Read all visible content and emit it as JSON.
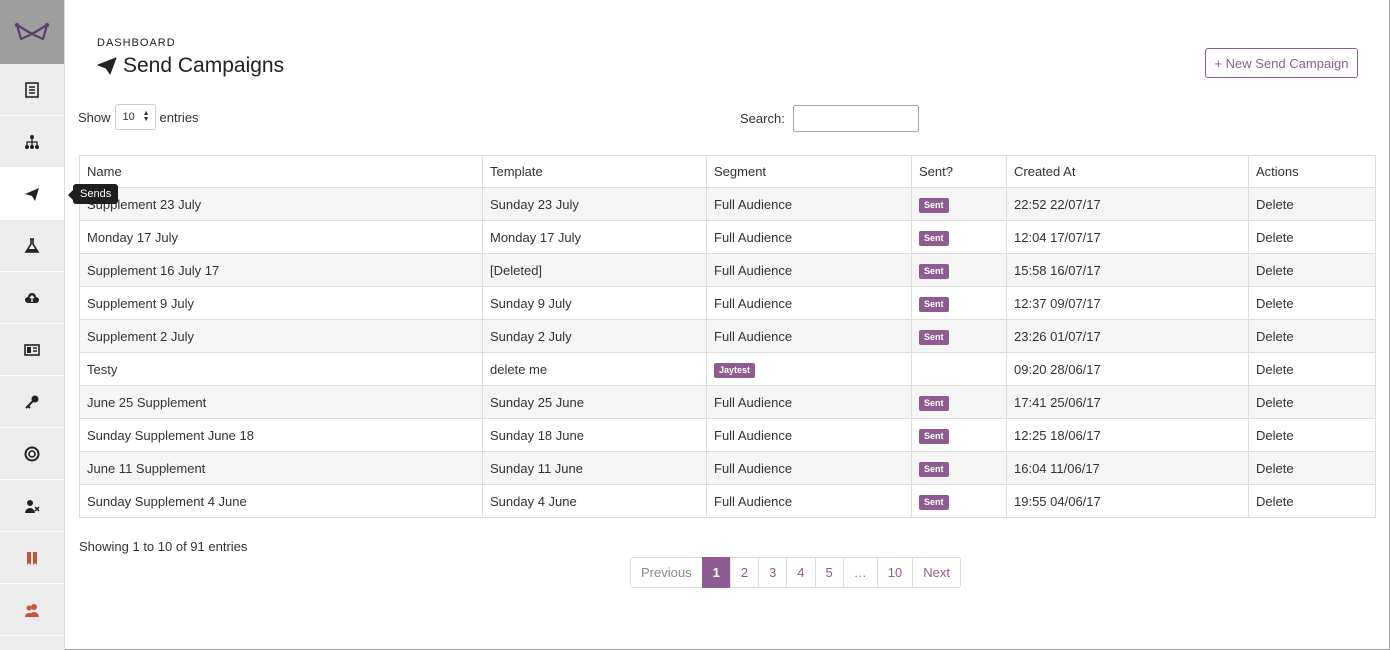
{
  "sidebar": {
    "logo_icon": "bowtie-logo-icon",
    "items": [
      {
        "icon": "document-icon"
      },
      {
        "icon": "sitemap-icon"
      },
      {
        "icon": "paper-plane-icon",
        "active": true
      },
      {
        "icon": "flask-icon"
      },
      {
        "icon": "cloud-upload-icon"
      },
      {
        "icon": "id-card-icon"
      },
      {
        "icon": "key-icon"
      },
      {
        "icon": "lifebuoy-icon"
      },
      {
        "icon": "user-remove-icon"
      },
      {
        "icon": "bookmark-icon",
        "color": "#c9513f"
      },
      {
        "icon": "users-icon",
        "color": "#c9513f"
      }
    ],
    "tooltip": "Sends"
  },
  "header": {
    "breadcrumb": "DASHBOARD",
    "title": "Send Campaigns",
    "new_button": "+ New Send Campaign"
  },
  "controls": {
    "show_label": "Show",
    "entries_value": "10",
    "entries_label": "entries",
    "search_label": "Search:",
    "search_value": ""
  },
  "table": {
    "columns": [
      "Name",
      "Template",
      "Segment",
      "Sent?",
      "Created At",
      "Actions"
    ],
    "rows": [
      {
        "name": "Supplement 23 July",
        "template": "Sunday 23 July",
        "segment": "Full Audience",
        "sent": "Sent",
        "created": "22:52 22/07/17",
        "action": "Delete"
      },
      {
        "name": "Monday 17 July",
        "template": "Monday 17 July",
        "segment": "Full Audience",
        "sent": "Sent",
        "created": "12:04 17/07/17",
        "action": "Delete"
      },
      {
        "name": "Supplement 16 July 17",
        "template": "[Deleted]",
        "segment": "Full Audience",
        "sent": "Sent",
        "created": "15:58 16/07/17",
        "action": "Delete"
      },
      {
        "name": "Supplement 9 July",
        "template": "Sunday 9 July",
        "segment": "Full Audience",
        "sent": "Sent",
        "created": "12:37 09/07/17",
        "action": "Delete"
      },
      {
        "name": "Supplement 2 July",
        "template": "Sunday 2 July",
        "segment": "Full Audience",
        "sent": "Sent",
        "created": "23:26 01/07/17",
        "action": "Delete"
      },
      {
        "name": "Testy",
        "template": "delete me",
        "segment_badge": "Jaytest",
        "sent": "",
        "created": "09:20 28/06/17",
        "action": "Delete"
      },
      {
        "name": "June 25 Supplement",
        "template": "Sunday 25 June",
        "segment": "Full Audience",
        "sent": "Sent",
        "created": "17:41 25/06/17",
        "action": "Delete"
      },
      {
        "name": "Sunday Supplement June 18",
        "template": "Sunday 18 June",
        "segment": "Full Audience",
        "sent": "Sent",
        "created": "12:25 18/06/17",
        "action": "Delete"
      },
      {
        "name": "June 11 Supplement",
        "template": "Sunday 11 June",
        "segment": "Full Audience",
        "sent": "Sent",
        "created": "16:04 11/06/17",
        "action": "Delete"
      },
      {
        "name": "Sunday Supplement 4 June",
        "template": "Sunday 4 June",
        "segment": "Full Audience",
        "sent": "Sent",
        "created": "19:55 04/06/17",
        "action": "Delete"
      }
    ]
  },
  "footer": {
    "info": "Showing 1 to 10 of 91 entries",
    "pagination": [
      "Previous",
      "1",
      "2",
      "3",
      "4",
      "5",
      "…",
      "10",
      "Next"
    ],
    "active_page": "1"
  },
  "colors": {
    "accent": "#8e5c91",
    "sidebar_bg": "#ececec",
    "logo_bg": "#9e9e9e"
  }
}
